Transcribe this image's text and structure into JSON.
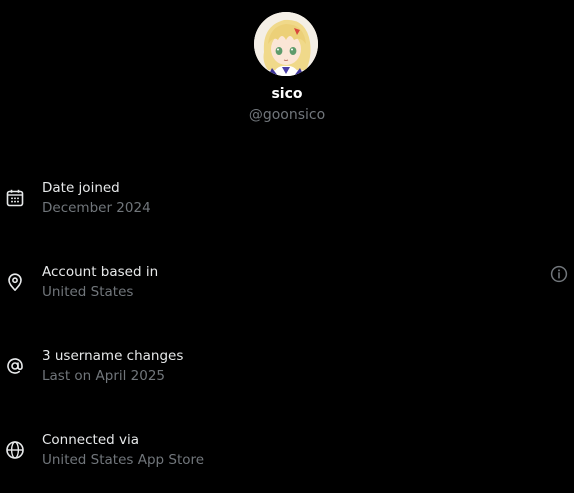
{
  "profile": {
    "display_name": "sico",
    "handle": "@goonsico"
  },
  "rows": [
    {
      "icon": "calendar-icon",
      "title": "Date joined",
      "subtitle": "December 2024"
    },
    {
      "icon": "location-pin-icon",
      "title": "Account based in",
      "subtitle": "United States",
      "has_info": true
    },
    {
      "icon": "at-sign-icon",
      "title": "3 username changes",
      "subtitle": "Last on April 2025"
    },
    {
      "icon": "globe-icon",
      "title": "Connected via",
      "subtitle": "United States App Store"
    }
  ],
  "colors": {
    "background": "#000000",
    "primary_text": "#e7e9ea",
    "secondary_text": "#71767b",
    "icon": "#e7e9ea"
  }
}
